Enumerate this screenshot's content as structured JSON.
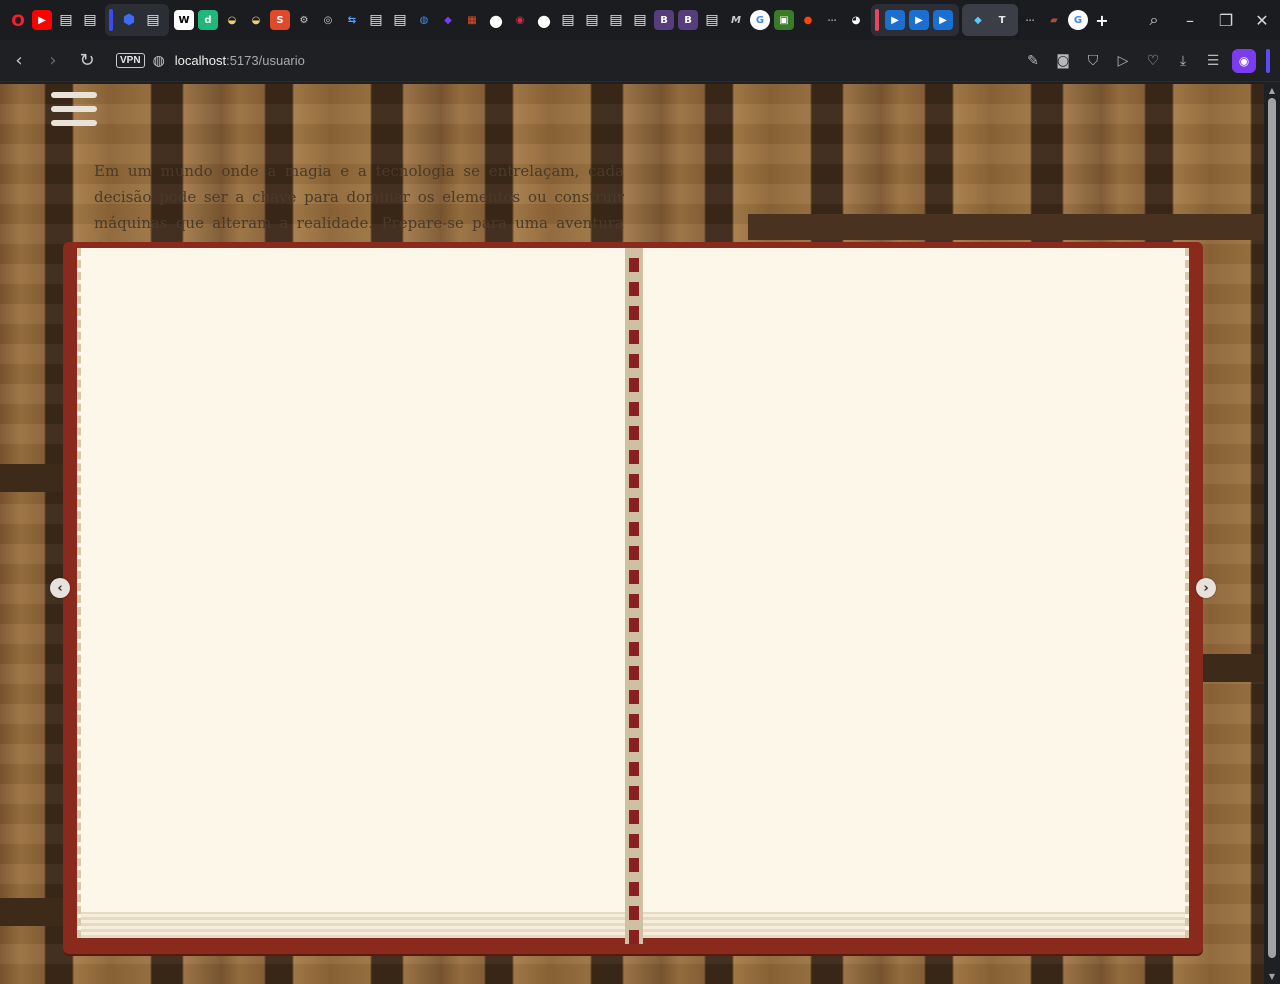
{
  "browser": {
    "tab_icons": [
      {
        "icon": "opera-icon",
        "color": "#ff1b2d",
        "glyph": "O"
      },
      {
        "icon": "youtube-icon",
        "color": "#ff0000",
        "glyph": "▶"
      },
      {
        "icon": "page-icon",
        "color": "#e8e8e8",
        "glyph": "▤"
      },
      {
        "icon": "page-icon",
        "color": "#e8e8e8",
        "glyph": "▤"
      }
    ],
    "url_host": "localhost",
    "url_path": ":5173/usuario",
    "vpn_label": "VPN",
    "active_tab_letter": "T"
  },
  "page": {
    "intro_text": "Em um mundo onde a magia e a tecnologia se entrelaçam, cada decisão pode ser a chave para dominar os elementos ou construir máquinas que alteram a realidade. Prepare-se para uma aventura épica!",
    "prev_arrow": "‹",
    "next_arrow": "›"
  },
  "colors": {
    "book_cover": "#8a2a1c",
    "page": "#fdf7ea",
    "accent": "#7b3cf0"
  }
}
